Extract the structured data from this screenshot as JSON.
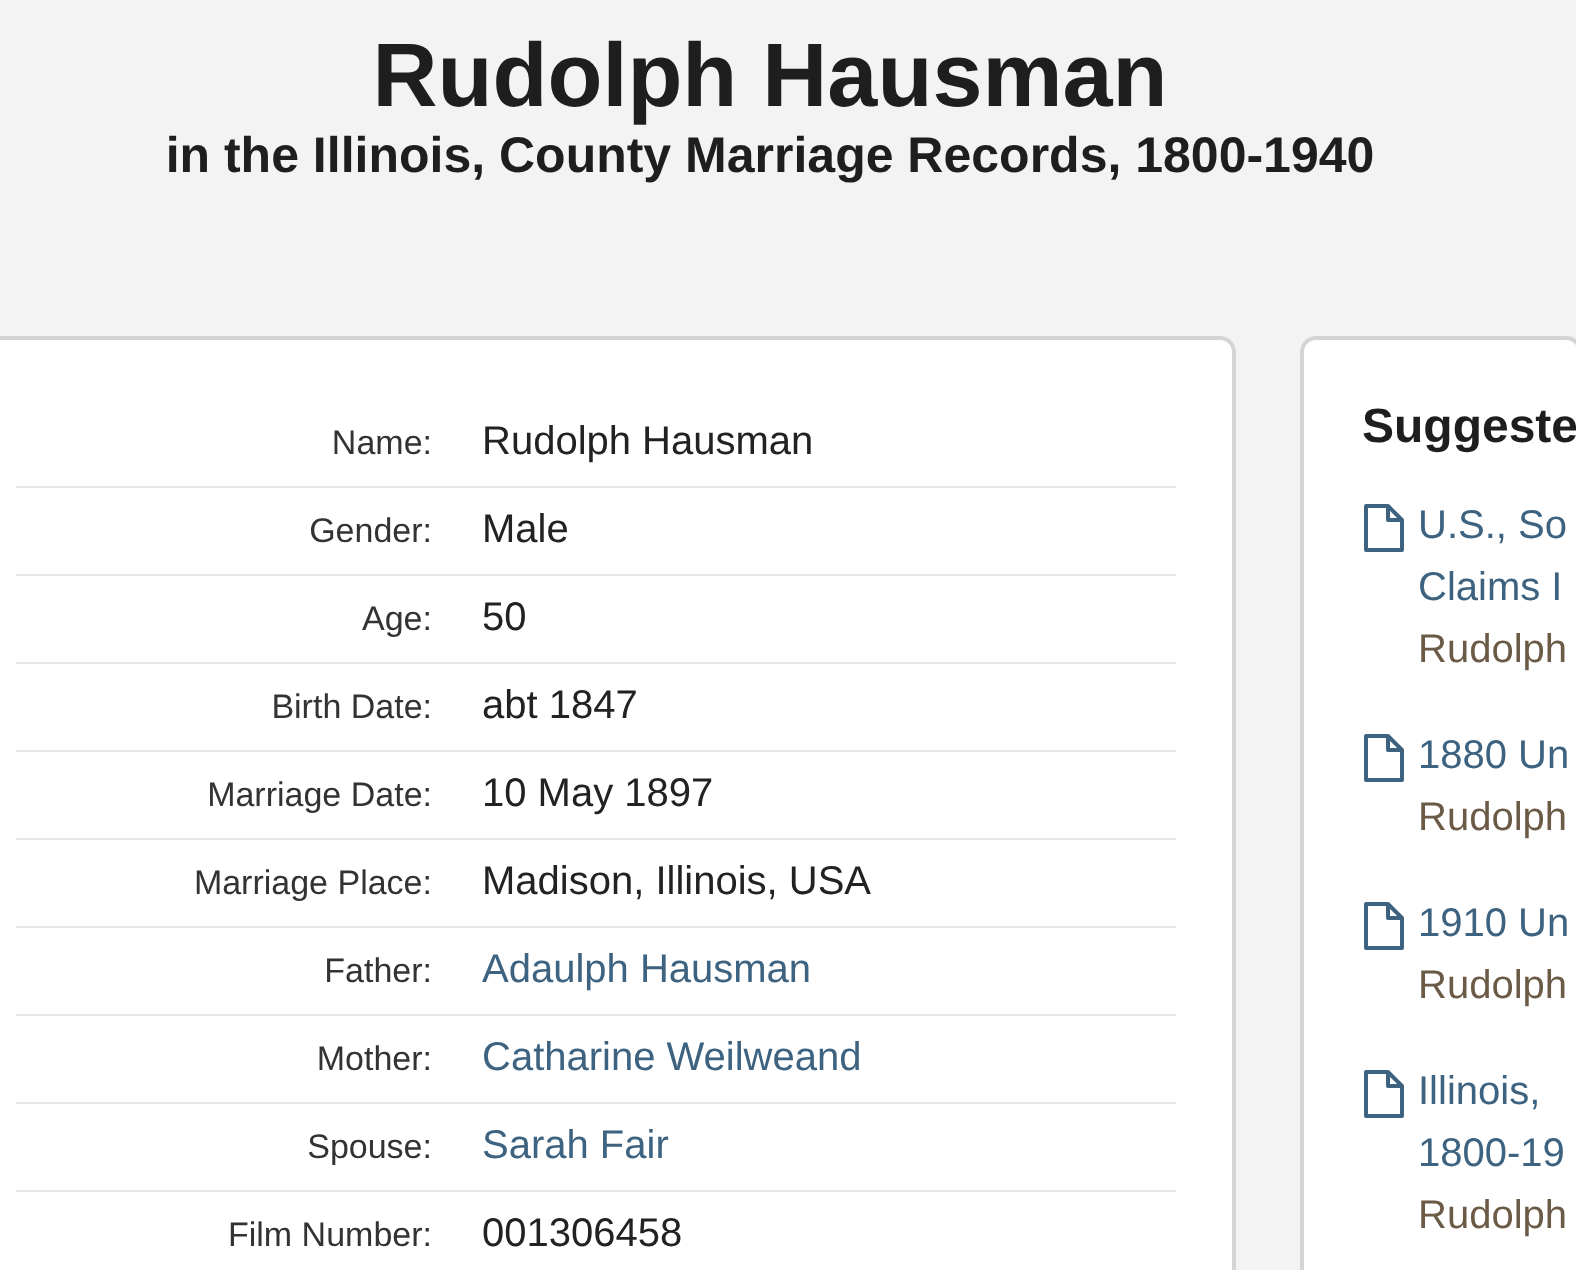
{
  "header": {
    "title": "Rudolph Hausman",
    "subtitle": "in the Illinois, County Marriage Records, 1800-1940"
  },
  "record": [
    {
      "label": "Name:",
      "value": "Rudolph Hausman",
      "kind": "text"
    },
    {
      "label": "Gender:",
      "value": "Male",
      "kind": "text"
    },
    {
      "label": "Age:",
      "value": "50",
      "kind": "text"
    },
    {
      "label": "Birth Date:",
      "value": "abt 1847",
      "kind": "text"
    },
    {
      "label": "Marriage Date:",
      "value": "10 May 1897",
      "kind": "text"
    },
    {
      "label": "Marriage Place:",
      "value": "Madison, Illinois, USA",
      "kind": "text"
    },
    {
      "label": "Father:",
      "value": "Adaulph Hausman",
      "kind": "link"
    },
    {
      "label": "Mother:",
      "value": "Catharine Weilweand",
      "kind": "link"
    },
    {
      "label": "Spouse:",
      "value": "Sarah Fair",
      "kind": "link"
    },
    {
      "label": "Film Number:",
      "value": "001306458",
      "kind": "text"
    }
  ],
  "suggested": {
    "heading": "Suggeste",
    "items": [
      {
        "title": [
          "U.S., So",
          "Claims I"
        ],
        "name": "Rudolph"
      },
      {
        "title": [
          "1880 Un"
        ],
        "name": "Rudolph"
      },
      {
        "title": [
          "1910 Un"
        ],
        "name": "Rudolph"
      },
      {
        "title": [
          "Illinois,",
          "1800-19"
        ],
        "name": "Rudolph"
      }
    ]
  }
}
